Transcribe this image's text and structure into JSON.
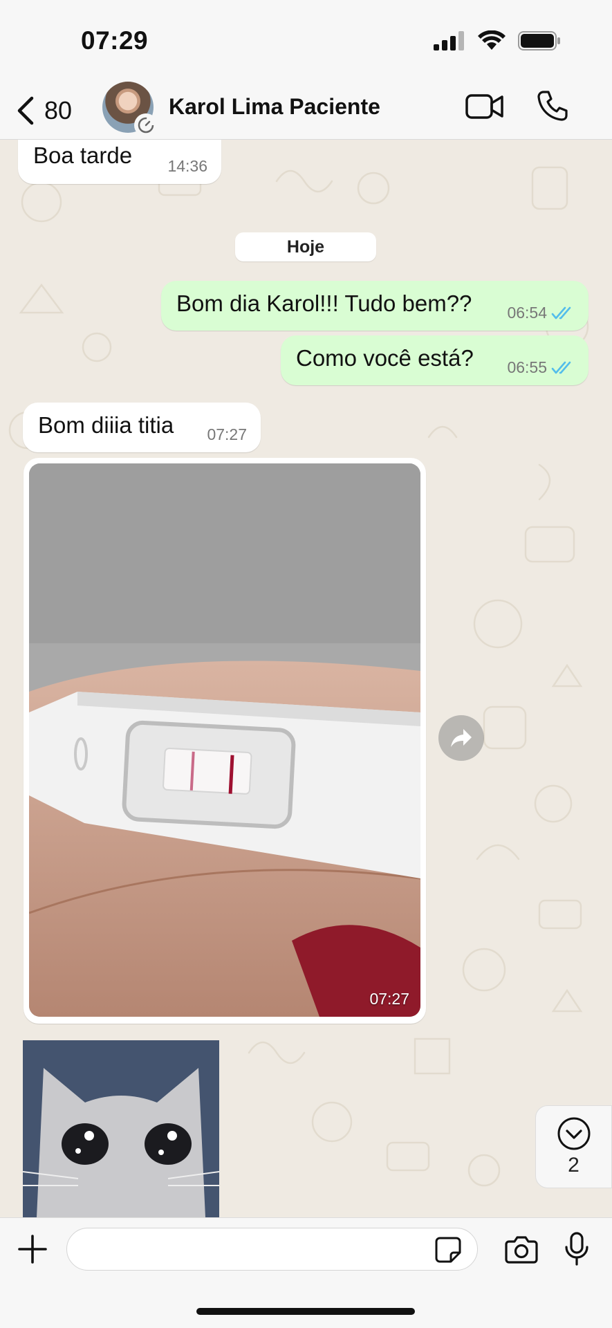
{
  "status_bar": {
    "time": "07:29"
  },
  "header": {
    "back_count": "80",
    "contact_name": "Karol Lima Paciente"
  },
  "chat": {
    "date_separator": "Hoje",
    "messages": [
      {
        "text": "Boa tarde",
        "time": "14:36",
        "direction": "in"
      },
      {
        "text": "Bom dia Karol!!! Tudo bem??",
        "time": "06:54",
        "direction": "out",
        "read": true
      },
      {
        "text": "Como você está?",
        "time": "06:55",
        "direction": "out",
        "read": true
      },
      {
        "text": "Bom diiia titia",
        "time": "07:27",
        "direction": "in"
      }
    ],
    "image_message": {
      "time": "07:27"
    },
    "scroll_down": {
      "unread_count": "2"
    }
  },
  "input_bar": {
    "placeholder": ""
  },
  "colors": {
    "outgoing_bubble": "#d9fdd3",
    "incoming_bubble": "#ffffff",
    "read_ticks": "#53bdeb",
    "chat_background": "#efeae2"
  }
}
